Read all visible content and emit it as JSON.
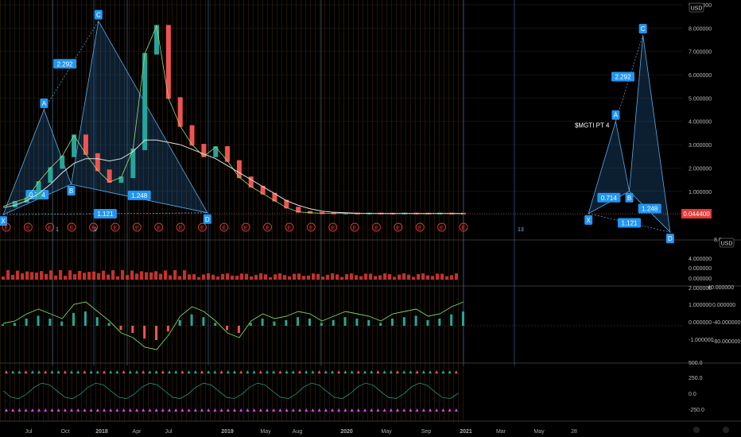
{
  "toolbar": {
    "currency_main": "USD",
    "currency_volume": "USD"
  },
  "chart_data": [
    {
      "type": "line",
      "panel": "price",
      "yscale": "linear",
      "ylim": [
        -0.95,
        9.0
      ],
      "price_axis_ticks": [
        "9.000000",
        "8.000000",
        "7.000000",
        "6.000000",
        "5.000000",
        "4.000000",
        "3.000000",
        "2.000000",
        "1.000000",
        "0.000000"
      ],
      "last_price": "0.044400",
      "time_axis": [
        "Jul",
        "Oct",
        "2018",
        "Apr",
        "Jul",
        "2019",
        "May",
        "Aug",
        "2020",
        "May",
        "Sep",
        "2021",
        "Mar",
        "May",
        "28"
      ],
      "series": [
        {
          "values": [
            0.35,
            0.55,
            0.7,
            1.4,
            2.0,
            2.5,
            3.4,
            2.6,
            1.9,
            1.4,
            1.6,
            2.8,
            6.9,
            8.1,
            5.0,
            3.8,
            3.0,
            2.5,
            2.9,
            2.3,
            1.6,
            1.2,
            0.9,
            0.6,
            0.3,
            0.12,
            0.08,
            0.06,
            0.05,
            0.05,
            0.045,
            0.05,
            0.045,
            0.044,
            0.05,
            0.045,
            0.044,
            0.05,
            0.045,
            0.044
          ]
        },
        {
          "values": [
            0.3,
            0.4,
            0.6,
            0.9,
            1.3,
            1.8,
            2.2,
            2.4,
            2.4,
            2.3,
            2.4,
            2.7,
            3.2,
            3.2,
            3.1,
            3.0,
            2.8,
            2.6,
            2.4,
            2.1,
            1.8,
            1.5,
            1.2,
            0.9,
            0.6,
            0.4,
            0.25,
            0.15,
            0.1,
            0.08,
            0.06,
            0.05,
            0.05,
            0.05,
            0.05,
            0.05,
            0.05,
            0.05,
            0.05,
            0.05
          ]
        }
      ],
      "patterns": [
        {
          "name": "$MGTI PT 4",
          "points": [
            {
              "label": "X",
              "time": "2017-06",
              "value": 0.0
            },
            {
              "label": "A",
              "time": "2017-09",
              "value": 4.5
            },
            {
              "label": "B",
              "time": "2017-11",
              "value": 1.3
            },
            {
              "label": "C",
              "time": "2018-01",
              "value": 8.3
            },
            {
              "label": "D",
              "time": "2018-09",
              "value": 0.08
            }
          ],
          "ratios": [
            "0.714",
            "2.292",
            "1.121",
            "1.248"
          ]
        },
        {
          "name": "$MGTI PT 4",
          "points": [
            {
              "label": "X",
              "time": "2021-01",
              "value": 0.044
            },
            {
              "label": "A",
              "time": "2021-03",
              "value": 4.0
            },
            {
              "label": "B",
              "time": "2021-04",
              "value": 1.0
            },
            {
              "label": "C",
              "time": "2021-05",
              "value": 7.7
            },
            {
              "label": "D",
              "time": "2021-07",
              "value": -0.75
            }
          ],
          "ratios": [
            "0.714",
            "2.292",
            "1.121",
            "1.248"
          ]
        }
      ],
      "earnings_markers": [
        "E",
        "E",
        "E",
        "E",
        "E",
        "E",
        "E",
        "E",
        "E",
        "E",
        "E",
        "E",
        "E",
        "E",
        "E",
        "E",
        "E",
        "E",
        "E",
        "E",
        "E",
        "E"
      ],
      "bar_counts": [
        "1",
        "2",
        "13"
      ],
      "colors": {
        "up": "#26a69a",
        "down": "#ef5350",
        "pattern": "#4aa3df",
        "label_bg": "#2196f3",
        "last_price_bg": "#e53935"
      }
    },
    {
      "type": "bar",
      "panel": "volume",
      "axis_ticks": [
        "4.000000",
        "0.000000",
        "0.000000",
        "2.000000"
      ],
      "axis_ticks_right": [
        "8.0",
        "40.000000"
      ]
    },
    {
      "type": "line",
      "panel": "oscillator",
      "axis_ticks": [
        "1.000000",
        "0.000000",
        "-1.000000"
      ],
      "axis_ticks_right": [
        "0.000000",
        "-40.000000",
        "-80.000000"
      ],
      "series": [
        {
          "values": [
            0.1,
            0.2,
            0.5,
            0.7,
            0.5,
            0.3,
            0.9,
            1.0,
            0.6,
            0.2,
            -0.3,
            -0.5,
            -0.9,
            -1.0,
            -0.4,
            0.4,
            0.8,
            0.6,
            0.2,
            -0.3,
            -0.5,
            0.2,
            0.5,
            0.3,
            0.4,
            0.6,
            0.5,
            0.2,
            0.4,
            0.6,
            0.5,
            0.4,
            0.2,
            0.5,
            0.6,
            0.7,
            0.4,
            0.5,
            0.8,
            1.0
          ]
        }
      ]
    },
    {
      "type": "scatter",
      "panel": "signals",
      "axis_ticks": [
        "500.0",
        "250.0",
        "0.0",
        "-250.0"
      ]
    }
  ]
}
